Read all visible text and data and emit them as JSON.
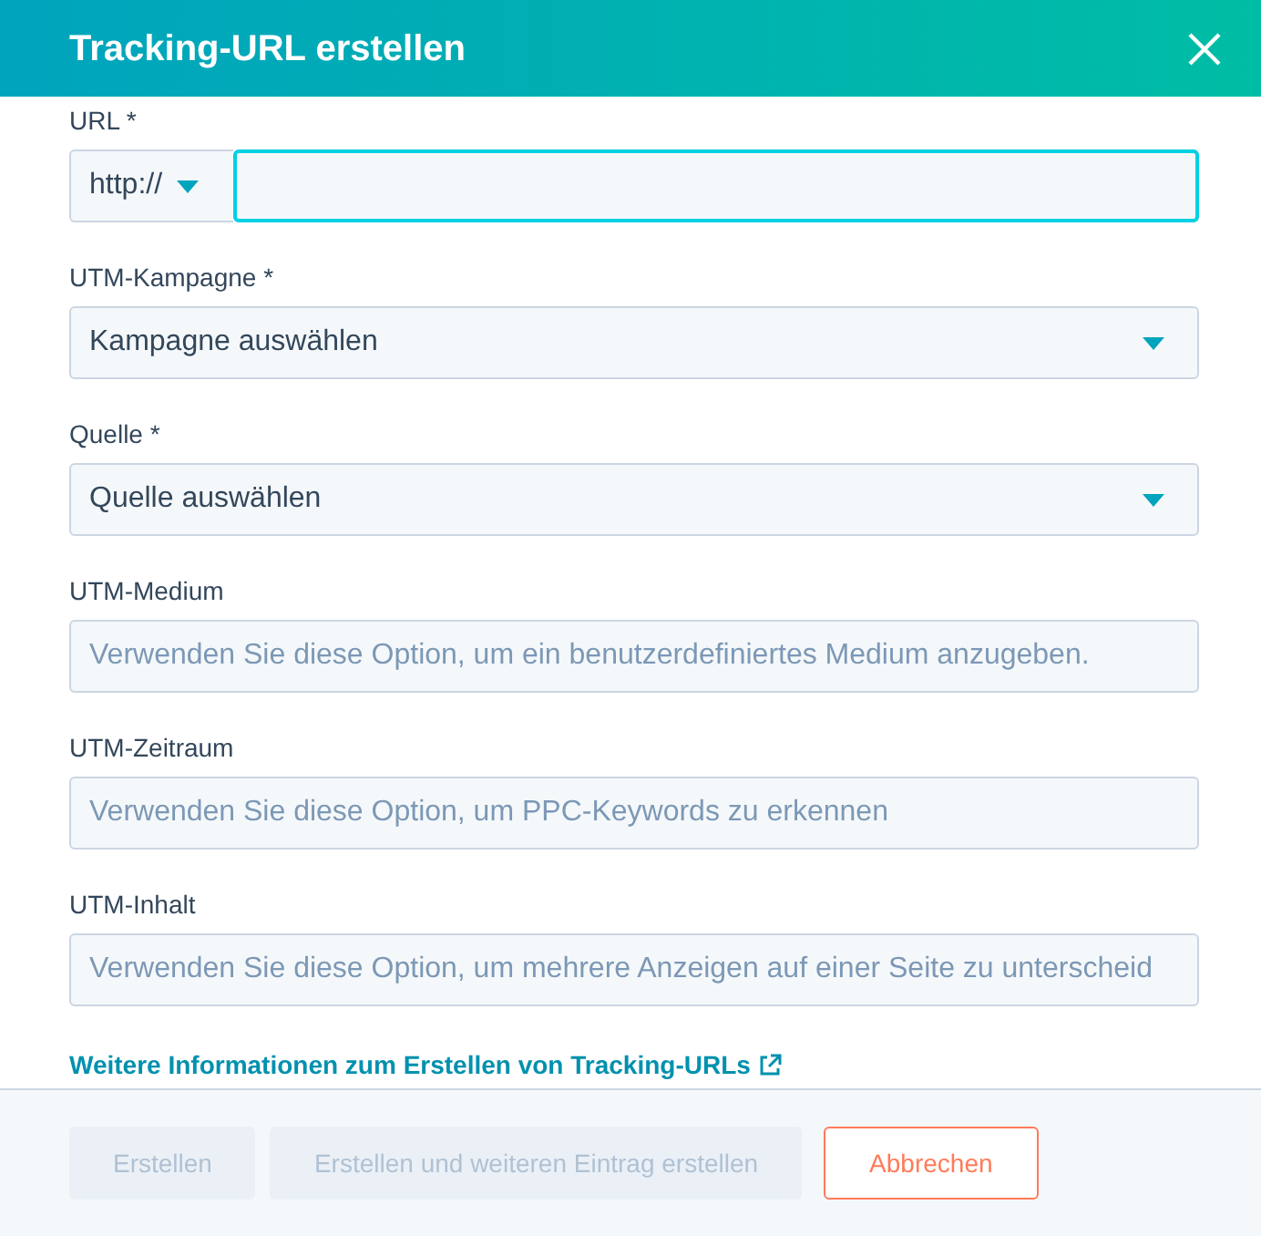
{
  "dialog": {
    "title": "Tracking-URL erstellen"
  },
  "fields": [
    {
      "kind": "url",
      "label": "URL *",
      "protocol": "http://",
      "focused": true
    },
    {
      "kind": "select",
      "label": "UTM-Kampagne *",
      "value": "Kampagne auswählen"
    },
    {
      "kind": "select",
      "label": "Quelle *",
      "value": "Quelle auswählen"
    },
    {
      "kind": "text",
      "label": "UTM-Medium",
      "placeholder": "Verwenden Sie diese Option, um ein benutzerdefiniertes Medium anzugeben."
    },
    {
      "kind": "text",
      "label": "UTM-Zeitraum",
      "placeholder": "Verwenden Sie diese Option, um PPC-Keywords zu erkennen"
    },
    {
      "kind": "text",
      "label": "UTM-Inhalt",
      "placeholder": "Verwenden Sie diese Option, um mehrere Anzeigen auf einer Seite zu unterscheid"
    }
  ],
  "help_link": "Weitere Informationen zum Erstellen von Tracking-URLs",
  "buttons": [
    {
      "kind": "primary",
      "label": "Erstellen",
      "disabled": true
    },
    {
      "kind": "secondary",
      "label": "Erstellen und weiteren Eintrag erstellen",
      "disabled": true
    },
    {
      "kind": "cancel",
      "label": "Abbrechen",
      "disabled": false
    }
  ]
}
